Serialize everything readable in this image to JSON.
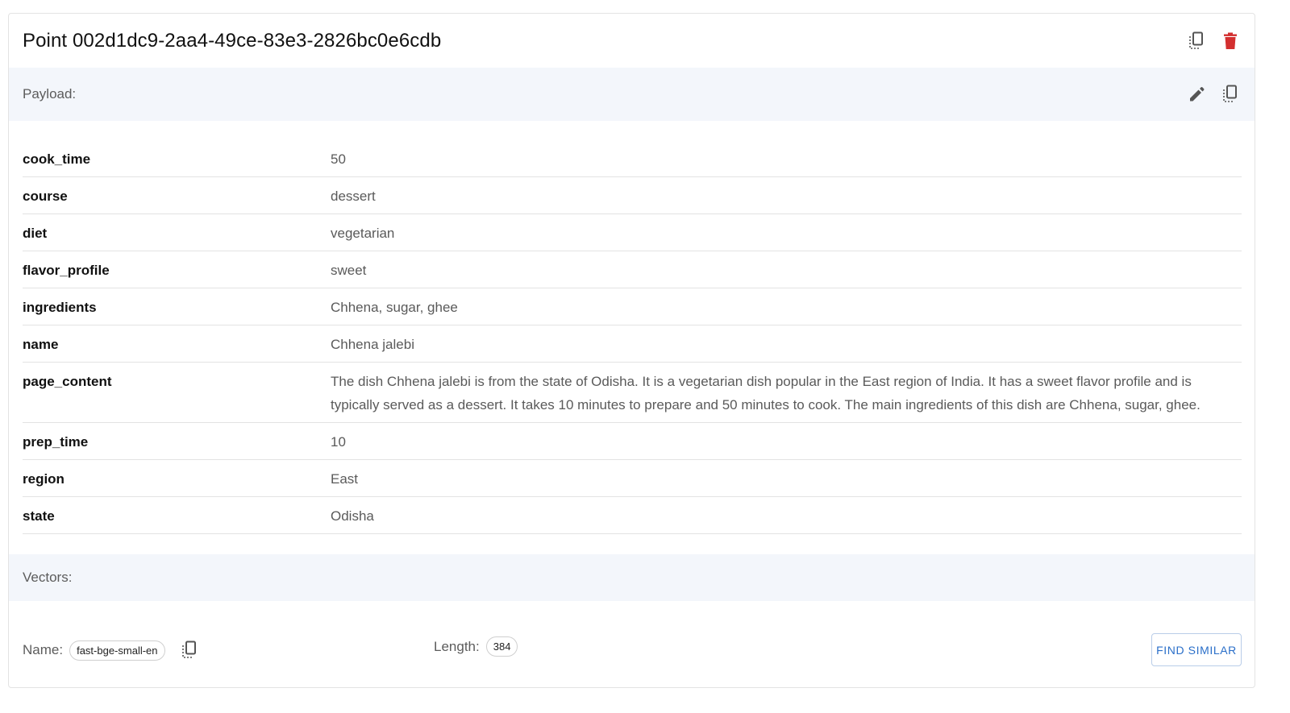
{
  "header": {
    "title": "Point 002d1dc9-2aa4-49ce-83e3-2826bc0e6cdb",
    "copy_icon": "copy-icon",
    "delete_icon": "trash-icon",
    "delete_color": "#d32f2f"
  },
  "payload": {
    "label": "Payload:",
    "edit_icon": "pencil-icon",
    "copy_icon": "copy-icon",
    "rows": [
      {
        "key": "cook_time",
        "value": "50"
      },
      {
        "key": "course",
        "value": "dessert"
      },
      {
        "key": "diet",
        "value": "vegetarian"
      },
      {
        "key": "flavor_profile",
        "value": "sweet"
      },
      {
        "key": "ingredients",
        "value": "Chhena, sugar, ghee"
      },
      {
        "key": "name",
        "value": "Chhena jalebi"
      },
      {
        "key": "page_content",
        "value": "The dish Chhena jalebi is from the state of Odisha. It is a vegetarian dish popular in the East region of India. It has a sweet flavor profile and is typically served as a dessert. It takes 10 minutes to prepare and 50 minutes to cook. The main ingredients of this dish are Chhena, sugar, ghee."
      },
      {
        "key": "prep_time",
        "value": "10"
      },
      {
        "key": "region",
        "value": "East"
      },
      {
        "key": "state",
        "value": "Odisha"
      }
    ]
  },
  "vectors": {
    "label": "Vectors:",
    "name_label": "Name:",
    "name_value": "fast-bge-small-en",
    "length_label": "Length:",
    "length_value": "384",
    "find_similar_label": "FIND SIMILAR",
    "accent": "#2a6fc9"
  }
}
